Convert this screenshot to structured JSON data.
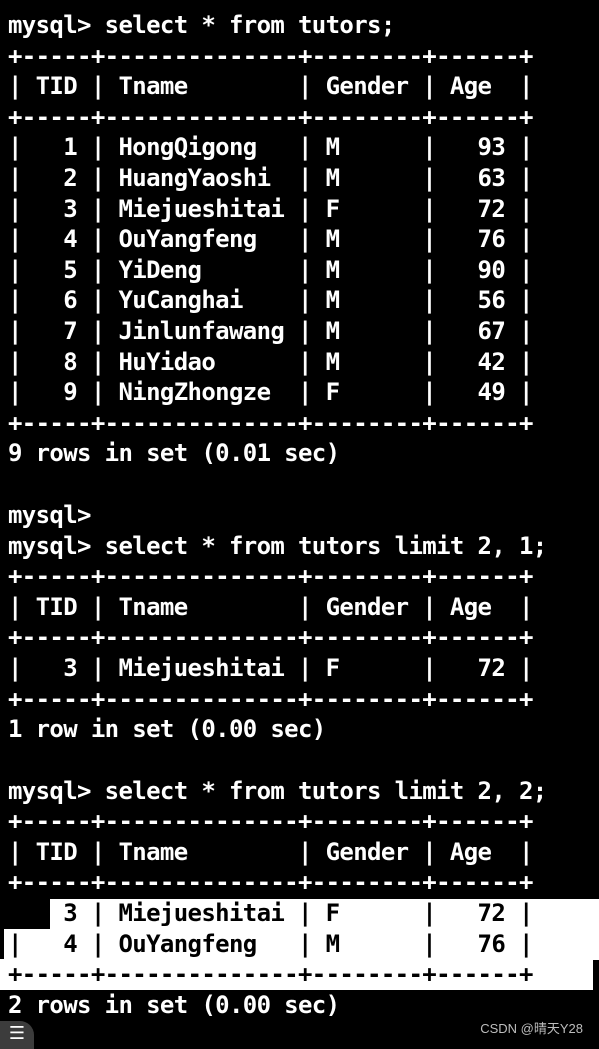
{
  "terminal": {
    "block1": {
      "command": "mysql> select * from tutors;",
      "border": "+-----+--------------+--------+------+",
      "header": "| TID | Tname        | Gender | Age  |",
      "rows": [
        "|   1 | HongQigong   | M      |   93 |",
        "|   2 | HuangYaoshi  | M      |   63 |",
        "|   3 | Miejueshitai | F      |   72 |",
        "|   4 | OuYangfeng   | M      |   76 |",
        "|   5 | YiDeng       | M      |   90 |",
        "|   6 | YuCanghai    | M      |   56 |",
        "|   7 | Jinlunfawang | M      |   67 |",
        "|   8 | HuYidao      | M      |   42 |",
        "|   9 | NingZhongze  | F      |   49 |"
      ],
      "status": "9 rows in set (0.01 sec)"
    },
    "empty_prompt": "mysql>",
    "block2": {
      "command": "mysql> select * from tutors limit 2, 1;",
      "border": "+-----+--------------+--------+------+",
      "header": "| TID | Tname        | Gender | Age  |",
      "rows": [
        "|   3 | Miejueshitai | F      |   72 |"
      ],
      "status": "1 row in set (0.00 sec)"
    },
    "block3": {
      "command": "mysql> select * from tutors limit 2, 2;",
      "border": "+-----+--------------+--------+------+",
      "header": "| TID | Tname        | Gender | Age  |",
      "rows": [
        "|   3 | Miejueshitai | F      |   72 |",
        "|   4 | OuYangfeng   | M      |   76 |"
      ],
      "status": "2 rows in set (0.00 sec)"
    }
  },
  "overlay": {
    "menu_icon": "menu-lines-icon",
    "menu_glyph": "☰",
    "watermark": "CSDN @晴天Y28"
  },
  "colors": {
    "background": "#000000",
    "text": "#ffffff",
    "selection": "#ffffff",
    "selection_text": "#000000"
  }
}
